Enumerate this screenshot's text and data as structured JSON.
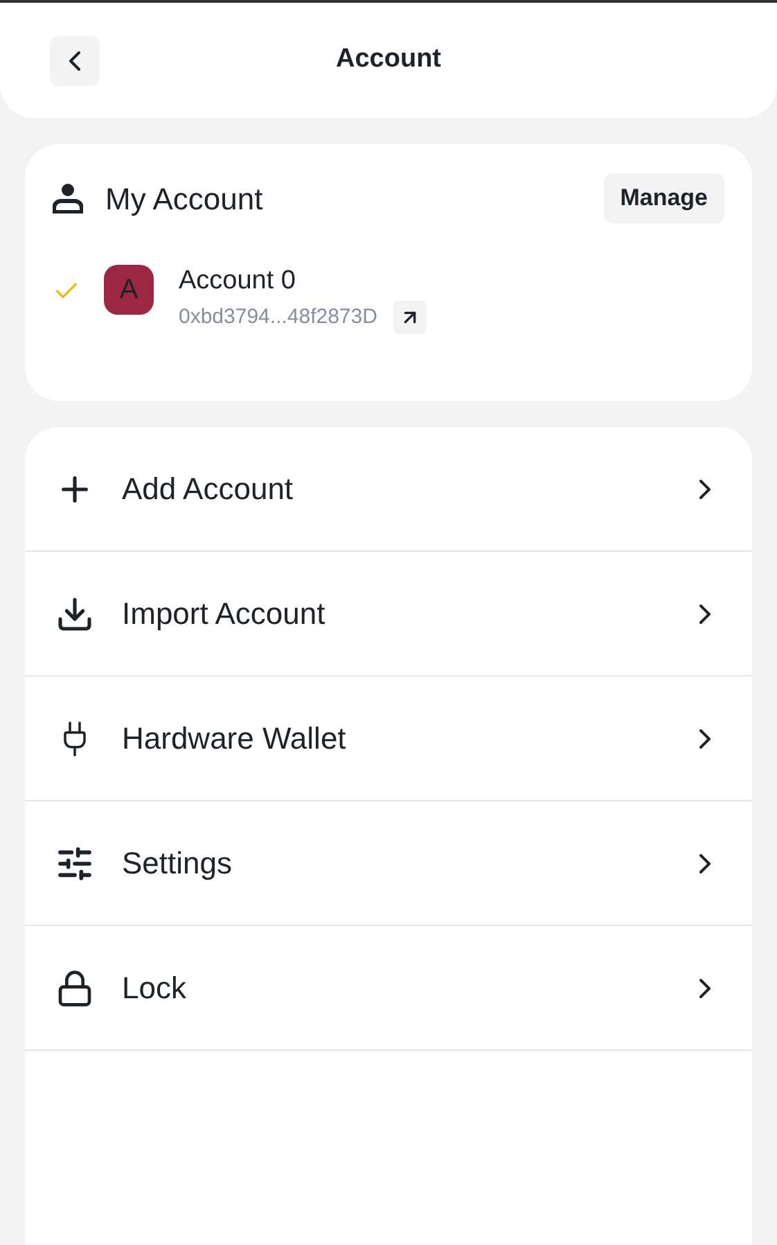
{
  "header": {
    "title": "Account"
  },
  "my_account": {
    "title": "My Account",
    "manage_button": "Manage",
    "accounts": [
      {
        "name": "Account 0",
        "address": "0xbd3794...48f2873D",
        "avatar_letter": "A",
        "color": "#9b2743",
        "selected": true
      }
    ]
  },
  "menu": [
    {
      "kind": "add",
      "label": "Add Account"
    },
    {
      "kind": "import",
      "label": "Import Account"
    },
    {
      "kind": "hardware",
      "label": "Hardware Wallet"
    },
    {
      "kind": "settings",
      "label": "Settings"
    },
    {
      "kind": "lock",
      "label": "Lock"
    }
  ]
}
